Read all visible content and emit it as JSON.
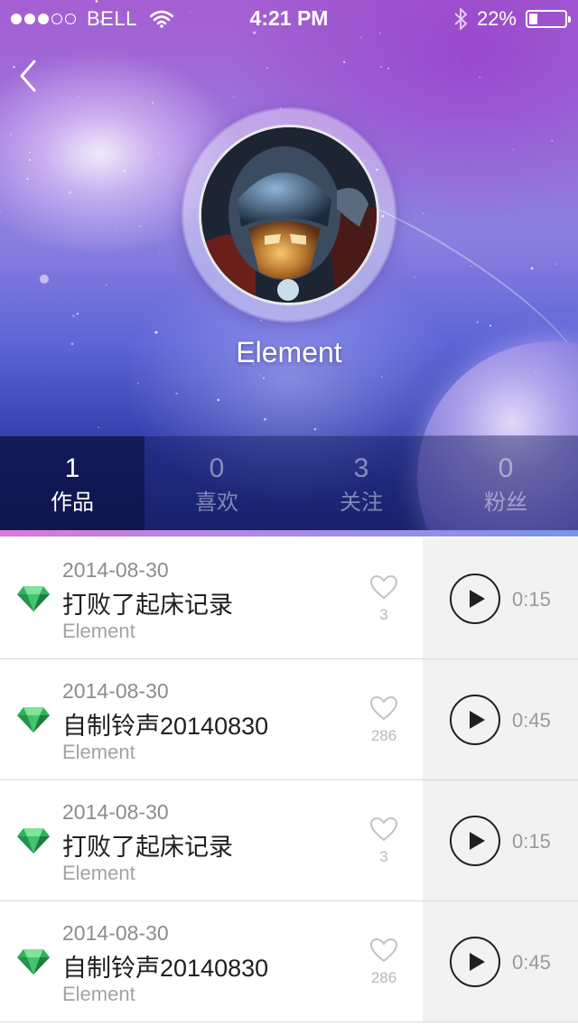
{
  "status_bar": {
    "signal_filled": 3,
    "signal_total": 5,
    "carrier": "BELL",
    "time": "4:21 PM",
    "battery_text": "22%",
    "battery_level": 0.22
  },
  "profile": {
    "username": "Element",
    "back_icon": "chevron-left-icon"
  },
  "stats": [
    {
      "num": "1",
      "label": "作品",
      "active": true
    },
    {
      "num": "0",
      "label": "喜欢",
      "active": false
    },
    {
      "num": "3",
      "label": "关注",
      "active": false
    },
    {
      "num": "0",
      "label": "粉丝",
      "active": false
    }
  ],
  "tracks": [
    {
      "date": "2014-08-30",
      "title": "打败了起床记录",
      "author": "Element",
      "likes": "3",
      "duration": "0:15"
    },
    {
      "date": "2014-08-30",
      "title": "自制铃声20140830",
      "author": "Element",
      "likes": "286",
      "duration": "0:45"
    },
    {
      "date": "2014-08-30",
      "title": "打败了起床记录",
      "author": "Element",
      "likes": "3",
      "duration": "0:15"
    },
    {
      "date": "2014-08-30",
      "title": "自制铃声20140830",
      "author": "Element",
      "likes": "286",
      "duration": "0:45"
    }
  ],
  "colors": {
    "accent_start": "#d77bd6",
    "accent_end": "#7a94e6",
    "gem": "#3cc46a"
  }
}
